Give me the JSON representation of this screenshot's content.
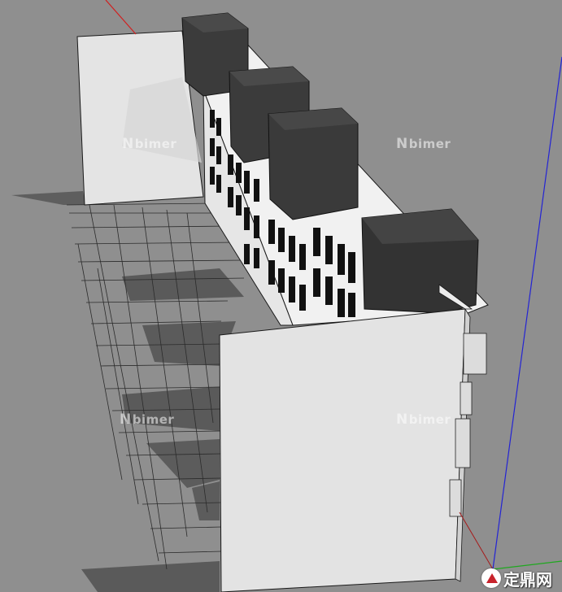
{
  "watermarks": [
    {
      "text": "bimer",
      "mark": "N"
    },
    {
      "text": "bimer",
      "mark": "N"
    },
    {
      "text": "bimer",
      "mark": "N"
    },
    {
      "text": "bimer",
      "mark": "N"
    }
  ],
  "brand": {
    "text": "定鼎网"
  },
  "colors": {
    "background": "#8f8f8f",
    "wall": "#e2e2e2",
    "block": "#3d3d3d",
    "shadow": "#5b5b5b",
    "axis_red": "#d11f1f",
    "axis_green": "#1fa81f",
    "axis_blue": "#2424d4",
    "brand_red": "#c8232c"
  },
  "icons": {
    "brand": "logo-icon"
  }
}
